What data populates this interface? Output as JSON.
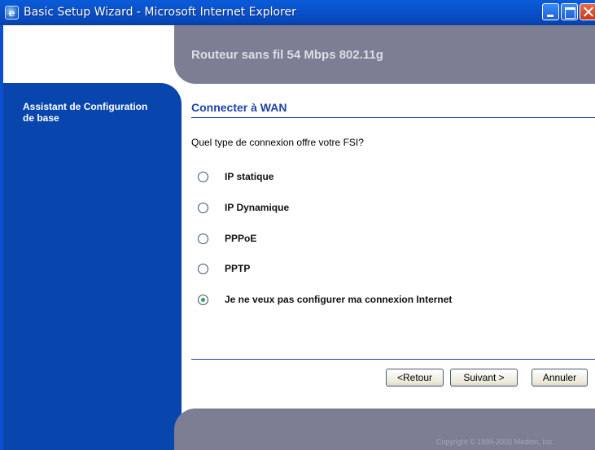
{
  "window": {
    "title": "Basic Setup Wizard - Microsoft Internet Explorer",
    "icon_name": "internet-explorer-icon",
    "icon_glyph": "e",
    "controls": [
      "minimize-icon",
      "maximize-icon",
      "close-icon"
    ]
  },
  "header": {
    "title": "Routeur sans fil 54 Mbps 802.11g",
    "band_color": "#7c7e93"
  },
  "sidebar": {
    "label": "Assistant de Configuration de base",
    "color": "#0845ad"
  },
  "main": {
    "section_title": "Connecter à WAN",
    "question": "Quel type de connexion offre votre FSI?",
    "options": [
      {
        "label": "IP statique",
        "checked": false
      },
      {
        "label": "IP Dynamique",
        "checked": false
      },
      {
        "label": "PPPoE",
        "checked": false
      },
      {
        "label": "PPTP",
        "checked": false
      },
      {
        "label": "Je ne veux pas configurer ma connexion Internet",
        "checked": true
      }
    ],
    "accent_color": "#1b44a8"
  },
  "buttons": {
    "back_label": "<Retour",
    "next_label": "Suivant >",
    "cancel_label": "Annuler"
  },
  "footer": {
    "copyright": "Copyright © 1999-2003 Medion, Inc."
  }
}
